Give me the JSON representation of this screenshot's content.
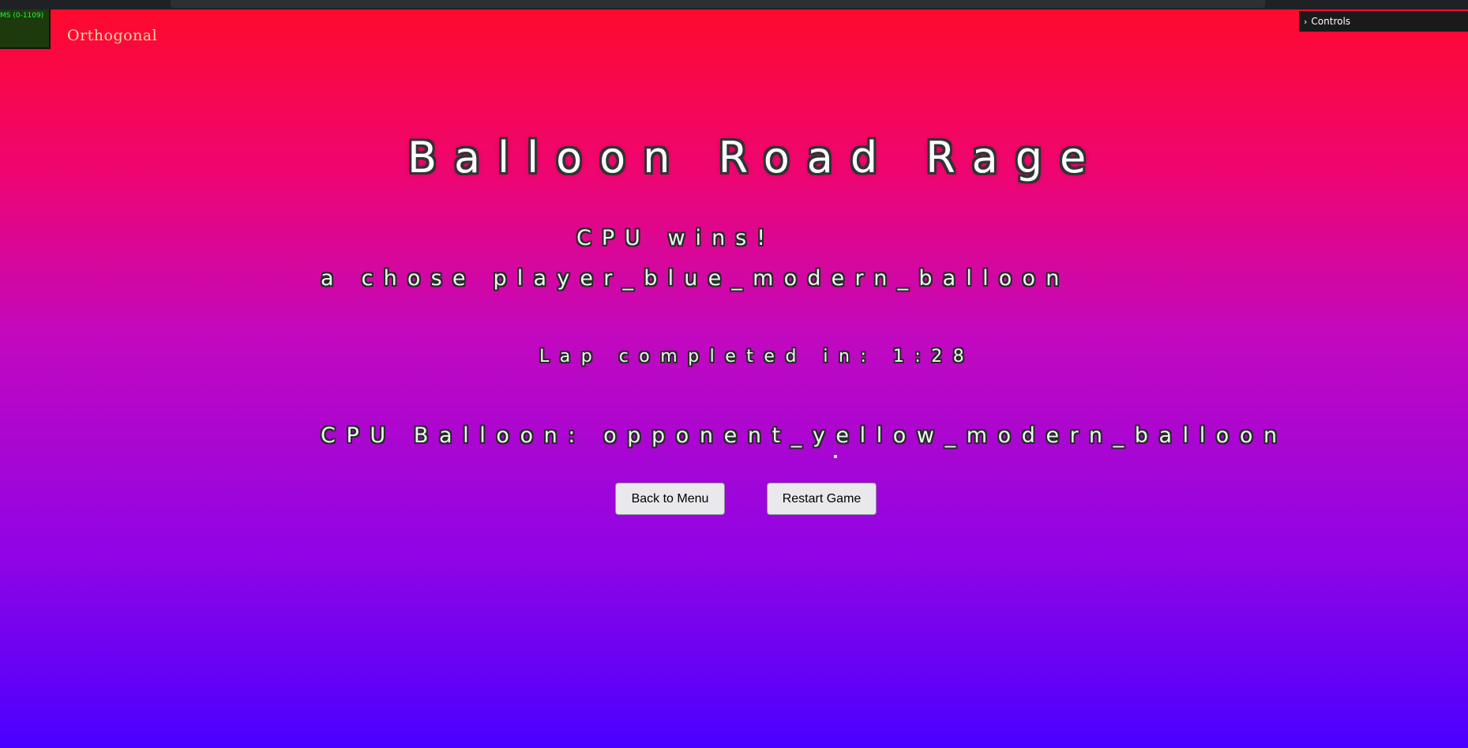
{
  "stats": {
    "label": "MS (0-1109)"
  },
  "camera": {
    "mode": "Orthogonal"
  },
  "controls": {
    "label": "Controls",
    "chevron": "›"
  },
  "game": {
    "title": "Balloon Road Rage",
    "winner": "CPU wins!",
    "choice": "a chose player_blue_modern_balloon",
    "lap": "Lap completed in: 1:28",
    "cpu_balloon": "CPU Balloon: opponent_yellow_modern_balloon"
  },
  "buttons": {
    "menu": "Back to Menu",
    "restart": "Restart Game"
  },
  "colors": {
    "gradient_top": "#ff0a2a",
    "gradient_bottom": "#4a00ff",
    "stats_text": "#1bff3a"
  }
}
